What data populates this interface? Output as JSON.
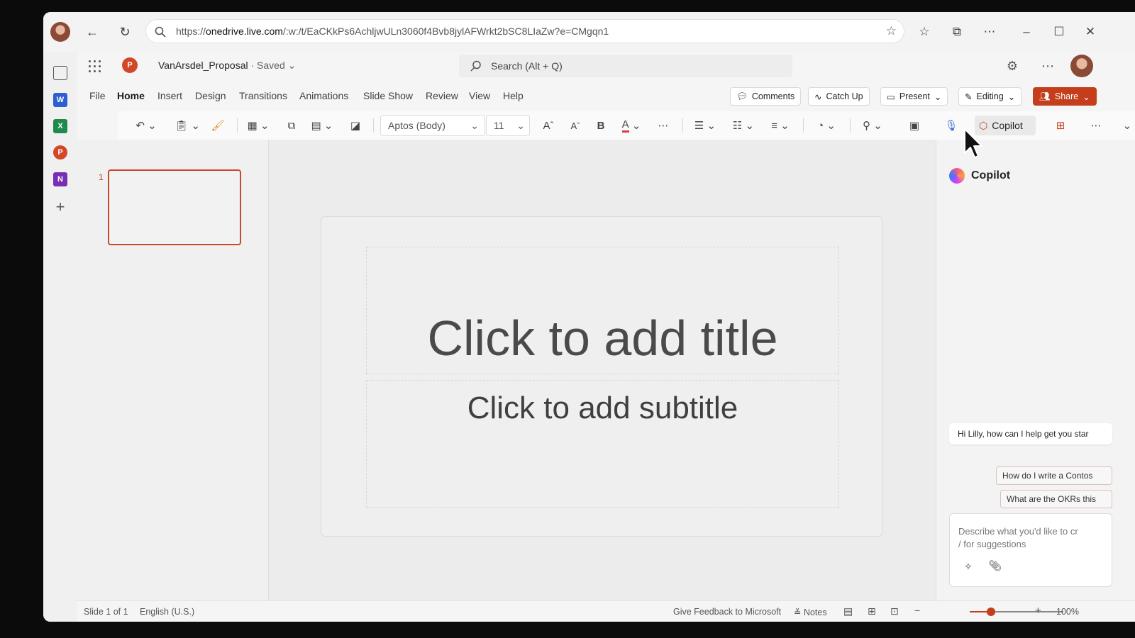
{
  "browser": {
    "url_prefix": "https://",
    "url_host": "onedrive.live.com",
    "url_path": "/:w:/t/EaCKkPs6AchljwULn3060f4Bvb8jylAFWrkt2bSC8LIaZw?e=CMgqn1"
  },
  "app": {
    "doc_name": "VanArsdel_Proposal",
    "doc_status": "· Saved",
    "search_placeholder": "Search (Alt + Q)",
    "brand_color": "#c43e1c"
  },
  "menu": {
    "tabs": [
      "File",
      "Home",
      "Insert",
      "Design",
      "Transitions",
      "Animations",
      "Slide Show",
      "Review",
      "View",
      "Help"
    ],
    "active_tab": "Home",
    "comments": "Comments",
    "catch_up": "Catch Up",
    "present": "Present",
    "editing": "Editing",
    "share": "Share"
  },
  "ribbon": {
    "font_name": "Aptos (Body)",
    "font_size": "11",
    "copilot_label": "Copilot"
  },
  "thumbs": {
    "slide_number": "1"
  },
  "slide": {
    "title_placeholder": "Click to add title",
    "subtitle_placeholder": "Click to add subtitle"
  },
  "copilot": {
    "title": "Copilot",
    "greeting": "Hi Lilly, how can I help get you star",
    "suggestions": [
      "How do I write a Contos",
      "What are the OKRs this"
    ],
    "input_line1": "Describe what you'd like to cr",
    "input_line2": "/ for suggestions"
  },
  "status": {
    "slide_count": "Slide 1 of 1",
    "language": "English (U.S.)",
    "feedback": "Give Feedback to Microsoft",
    "notes": "Notes",
    "zoom": "100%"
  }
}
